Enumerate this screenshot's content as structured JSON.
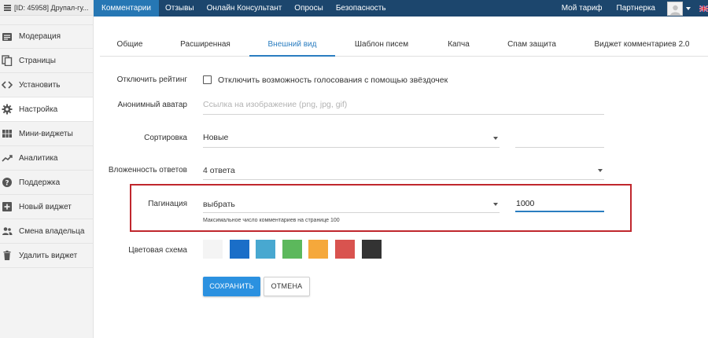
{
  "sidebar": {
    "site_title": "[ID: 45958] Друпал-гу...",
    "items": [
      {
        "label": "Модерация",
        "icon": "moderation-icon",
        "active": false
      },
      {
        "label": "Страницы",
        "icon": "pages-icon",
        "active": false
      },
      {
        "label": "Установить",
        "icon": "code-icon",
        "active": false
      },
      {
        "label": "Настройка",
        "icon": "gear-icon",
        "active": true
      },
      {
        "label": "Мини-виджеты",
        "icon": "grid-icon",
        "active": false
      },
      {
        "label": "Аналитика",
        "icon": "trend-icon",
        "active": false
      },
      {
        "label": "Поддержка",
        "icon": "help-icon",
        "active": false
      },
      {
        "label": "Новый виджет",
        "icon": "plus-box-icon",
        "active": false
      },
      {
        "label": "Смена владельца",
        "icon": "users-icon",
        "active": false
      },
      {
        "label": "Удалить виджет",
        "icon": "trash-icon",
        "active": false
      }
    ]
  },
  "topnav": {
    "items": [
      "Комментарии",
      "Отзывы",
      "Онлайн Консультант",
      "Опросы",
      "Безопасность"
    ],
    "active_index": 0,
    "right_items": [
      "Мой тариф",
      "Партнерка"
    ],
    "avatar_icon": "user-avatar-icon",
    "flag_icon": "uk-flag-icon"
  },
  "tabs": {
    "items": [
      "Общие",
      "Расширенная",
      "Внешний вид",
      "Шаблон писем",
      "Капча",
      "Спам защита",
      "Виджет комментариев 2.0"
    ],
    "active_index": 2
  },
  "form": {
    "rating_label": "Отключить рейтинг",
    "rating_checkbox_label": "Отключить возможность голосования с помощью звёздочек",
    "rating_checked": false,
    "avatar_label": "Анонимный аватар",
    "avatar_placeholder": "Ссылка на изображение (png, jpg, gif)",
    "avatar_value": "",
    "sort_label": "Сортировка",
    "sort_value": "Новые",
    "sort_extra_value": "",
    "nesting_label": "Вложенность ответов",
    "nesting_value": "4 ответа",
    "pagination_label": "Пагинация",
    "pagination_select": "выбрать",
    "pagination_value": "1000",
    "pagination_helper": "Максимальное число комментариев на странице 100",
    "color_label": "Цветовая схема",
    "colors": [
      "#f4f4f4",
      "#1a6ec8",
      "#48a8d0",
      "#5cb85c",
      "#f5a83b",
      "#d9534f",
      "#333333"
    ],
    "save_label": "СОХРАНИТЬ",
    "cancel_label": "ОТМЕНА"
  },
  "accent_colors": {
    "topnav_bg": "#1c466d",
    "topnav_active": "#2677b4",
    "tab_active": "#2a7dc0",
    "highlight_border": "#c0272d",
    "primary_button": "#2b91e0"
  }
}
